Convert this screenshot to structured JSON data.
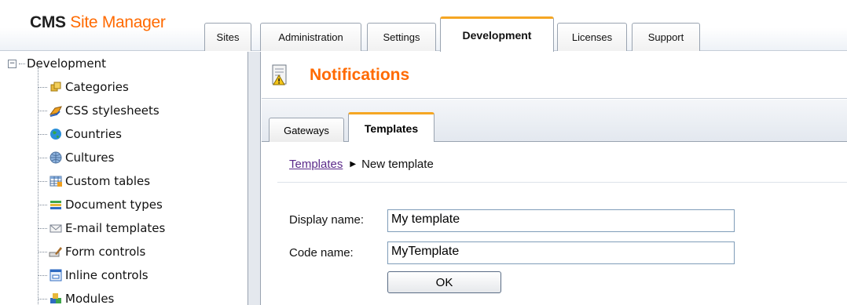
{
  "app": {
    "logo_bold": "CMS",
    "logo_rest": " Site Manager"
  },
  "top_tabs": [
    {
      "label": "Sites"
    },
    {
      "label": "Administration"
    },
    {
      "label": "Settings"
    },
    {
      "label": "Development",
      "active": true
    },
    {
      "label": "Licenses"
    },
    {
      "label": "Support"
    }
  ],
  "tree": {
    "root": "Development",
    "items": [
      {
        "label": "Categories",
        "icon": "categories-icon"
      },
      {
        "label": "CSS stylesheets",
        "icon": "css-stylesheets-icon"
      },
      {
        "label": "Countries",
        "icon": "countries-icon"
      },
      {
        "label": "Cultures",
        "icon": "cultures-icon"
      },
      {
        "label": "Custom tables",
        "icon": "custom-tables-icon"
      },
      {
        "label": "Document types",
        "icon": "document-types-icon"
      },
      {
        "label": "E-mail templates",
        "icon": "email-templates-icon"
      },
      {
        "label": "Form controls",
        "icon": "form-controls-icon"
      },
      {
        "label": "Inline controls",
        "icon": "inline-controls-icon"
      },
      {
        "label": "Modules",
        "icon": "modules-icon"
      }
    ]
  },
  "main": {
    "title": "Notifications",
    "tabs": [
      {
        "label": "Gateways"
      },
      {
        "label": "Templates",
        "active": true
      }
    ],
    "breadcrumb": {
      "link": "Templates",
      "current": "New template"
    },
    "form": {
      "display_name_label": "Display name:",
      "display_name_value": "My template",
      "code_name_label": "Code name:",
      "code_name_value": "MyTemplate",
      "ok_label": "OK"
    }
  },
  "colors": {
    "accent": "#ff6a00",
    "active_tab": "#f5a623",
    "link": "#5b2a8a"
  }
}
